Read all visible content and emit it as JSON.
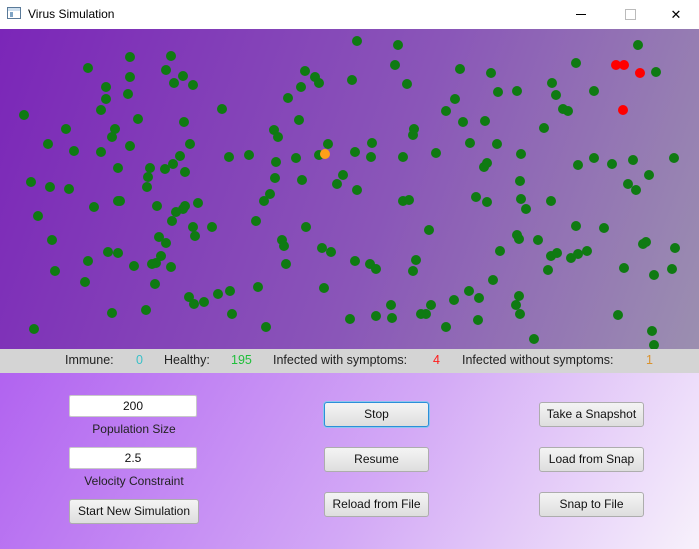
{
  "window": {
    "title": "Virus Simulation",
    "icon": "app-window-icon",
    "controls": {
      "minimize": "minimize-icon",
      "maximize": "maximize-icon",
      "close": "close-icon"
    }
  },
  "simulation": {
    "background": {
      "from": "#7b26b8",
      "to": "#9b8fb0"
    },
    "colors": {
      "healthy": "#0f7a12",
      "symptomatic": "#ff0000",
      "asymptomatic": "#ffa01a"
    }
  },
  "stats": {
    "immune_label": "Immune:",
    "immune_value": "0",
    "immune_color": "#39c0c8",
    "healthy_label": "Healthy:",
    "healthy_value": "195",
    "healthy_color": "#1fbf3a",
    "symptoms_label": "Infected with symptoms:",
    "symptoms_value": "4",
    "symptoms_color": "#ff1a1a",
    "nosymptoms_label": "Infected without symptoms:",
    "nosymptoms_value": "1",
    "nosymptoms_color": "#d9922e"
  },
  "controls": {
    "population_value": "200",
    "population_label": "Population Size",
    "velocity_value": "2.5",
    "velocity_label": "Velocity Constraint",
    "start_new_label": "Start New Simulation",
    "stop_label": "Stop",
    "resume_label": "Resume",
    "reload_label": "Reload from File",
    "snapshot_label": "Take a Snapshot",
    "load_snap_label": "Load from Snap",
    "snap_file_label": "Snap to File"
  }
}
